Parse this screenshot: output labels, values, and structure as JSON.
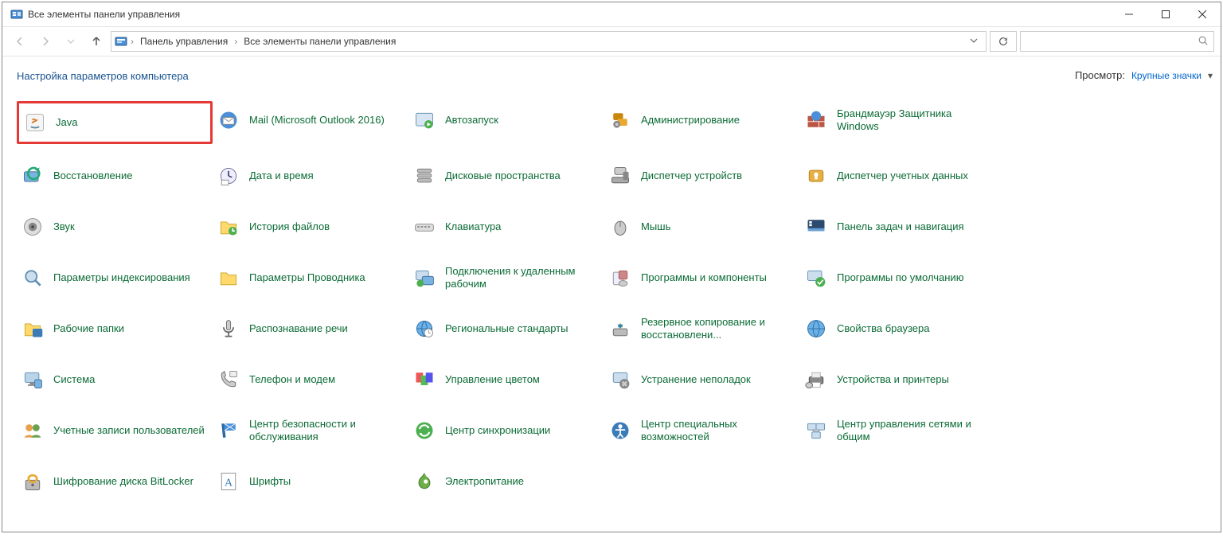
{
  "window": {
    "title": "Все элементы панели управления"
  },
  "breadcrumb": {
    "root": "Панель управления",
    "current": "Все элементы панели управления"
  },
  "header": {
    "title": "Настройка параметров компьютера"
  },
  "view": {
    "label": "Просмотр:",
    "selected": "Крупные значки"
  },
  "items": [
    {
      "label": "Java",
      "icon": "java",
      "hi": true
    },
    {
      "label": "Mail (Microsoft Outlook 2016)",
      "icon": "mail"
    },
    {
      "label": "Автозапуск",
      "icon": "autorun"
    },
    {
      "label": "Администрирование",
      "icon": "admin"
    },
    {
      "label": "Брандмауэр Защитника Windows",
      "icon": "firewall"
    },
    {
      "label": "Восстановление",
      "icon": "restore"
    },
    {
      "label": "Дата и время",
      "icon": "clock"
    },
    {
      "label": "Дисковые пространства",
      "icon": "drives"
    },
    {
      "label": "Диспетчер устройств",
      "icon": "devmgr"
    },
    {
      "label": "Диспетчер учетных данных",
      "icon": "creds"
    },
    {
      "label": "Звук",
      "icon": "sound"
    },
    {
      "label": "История файлов",
      "icon": "filehist"
    },
    {
      "label": "Клавиатура",
      "icon": "keyboard"
    },
    {
      "label": "Мышь",
      "icon": "mouse"
    },
    {
      "label": "Панель задач и навигация",
      "icon": "taskbar"
    },
    {
      "label": "Параметры индексирования",
      "icon": "indexing"
    },
    {
      "label": "Параметры Проводника",
      "icon": "folder"
    },
    {
      "label": "Подключения к удаленным рабочим",
      "icon": "remote"
    },
    {
      "label": "Программы и компоненты",
      "icon": "programs"
    },
    {
      "label": "Программы по умолчанию",
      "icon": "defaults"
    },
    {
      "label": "Рабочие папки",
      "icon": "workfolders"
    },
    {
      "label": "Распознавание речи",
      "icon": "speech"
    },
    {
      "label": "Региональные стандарты",
      "icon": "region"
    },
    {
      "label": "Резервное копирование и восстановлени...",
      "icon": "backup"
    },
    {
      "label": "Свойства браузера",
      "icon": "browser"
    },
    {
      "label": "Система",
      "icon": "system"
    },
    {
      "label": "Телефон и модем",
      "icon": "phone"
    },
    {
      "label": "Управление цветом",
      "icon": "color"
    },
    {
      "label": "Устранение неполадок",
      "icon": "trouble"
    },
    {
      "label": "Устройства и принтеры",
      "icon": "printers"
    },
    {
      "label": "Учетные записи пользователей",
      "icon": "users"
    },
    {
      "label": "Центр безопасности и обслуживания",
      "icon": "security"
    },
    {
      "label": "Центр синхронизации",
      "icon": "sync"
    },
    {
      "label": "Центр специальных возможностей",
      "icon": "access"
    },
    {
      "label": "Центр управления сетями и общим",
      "icon": "network"
    },
    {
      "label": "Шифрование диска BitLocker",
      "icon": "bitlocker"
    },
    {
      "label": "Шрифты",
      "icon": "fonts"
    },
    {
      "label": "Электропитание",
      "icon": "power"
    }
  ]
}
